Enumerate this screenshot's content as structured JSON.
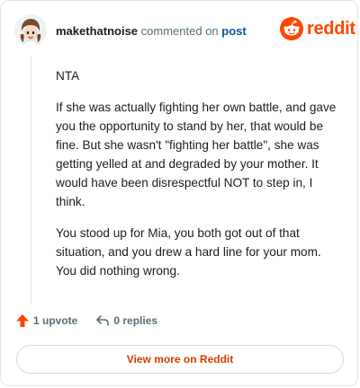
{
  "header": {
    "username": "makethatnoise",
    "commented_text": "commented on",
    "post_link": "post",
    "brand": "reddit"
  },
  "comment": {
    "paragraphs": [
      "NTA",
      "If she was actually fighting her own battle, and gave you the opportunity to stand by her, that would be fine. But she wasn't \"fighting her battle\", she was getting yelled at and degraded by your mother. It would have been disrespectful NOT to step in, I think.",
      "You stood up for Mia, you both got out of that situation, and you drew a hard line for your mom. You did nothing wrong."
    ]
  },
  "actions": {
    "upvote_label": "1 upvote",
    "replies_label": "0 replies"
  },
  "footer": {
    "view_more_label": "View more on Reddit"
  },
  "colors": {
    "brand": "#ff4500",
    "link": "#0a53a0",
    "button_text": "#d93a00",
    "muted": "#576f76"
  },
  "icons": {
    "avatar": "avatar-illustration",
    "logo": "reddit-snoo-icon",
    "upvote": "upvote-arrow-icon",
    "reply": "reply-arrow-icon"
  }
}
